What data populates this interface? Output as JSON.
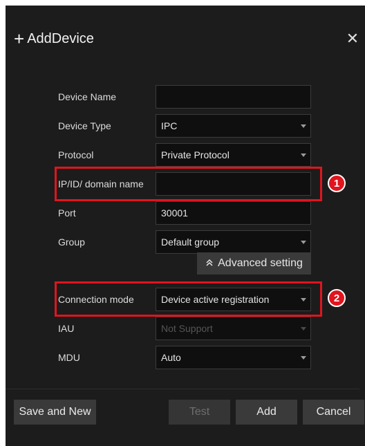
{
  "dialog": {
    "title": "AddDevice",
    "plus_glyph": "+",
    "close_glyph": "✕"
  },
  "form": {
    "device_name": {
      "label": "Device Name",
      "value": ""
    },
    "device_type": {
      "label": "Device Type",
      "value": "IPC"
    },
    "protocol": {
      "label": "Protocol",
      "value": "Private Protocol"
    },
    "ip_domain": {
      "label": "IP/ID/ domain name",
      "value": ""
    },
    "port": {
      "label": "Port",
      "value": "30001"
    },
    "group": {
      "label": "Group",
      "value": "Default group"
    },
    "advanced_label": "Advanced setting",
    "connection_mode": {
      "label": "Connection mode",
      "value": "Device active registration"
    },
    "iau": {
      "label": "IAU",
      "value": "Not Support"
    },
    "mdu": {
      "label": "MDU",
      "value": "Auto"
    }
  },
  "annotations": {
    "badge_1": "1",
    "badge_2": "2",
    "highlight_color": "#e0151e"
  },
  "buttons": {
    "save_new": "Save and New",
    "test": "Test",
    "add": "Add",
    "cancel": "Cancel"
  }
}
